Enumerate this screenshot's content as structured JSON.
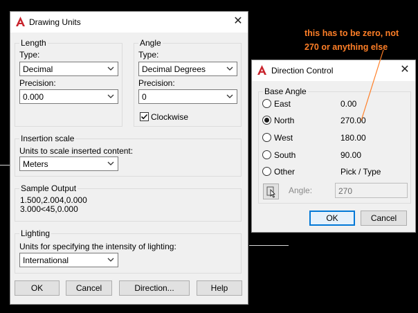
{
  "drawing_units": {
    "title": "Drawing Units",
    "length": {
      "group_title": "Length",
      "type_label": "Type:",
      "type_value": "Decimal",
      "precision_label": "Precision:",
      "precision_value": "0.000"
    },
    "angle": {
      "group_title": "Angle",
      "type_label": "Type:",
      "type_value": "Decimal Degrees",
      "precision_label": "Precision:",
      "precision_value": "0",
      "clockwise_label": "Clockwise",
      "clockwise_checked": true
    },
    "insertion": {
      "group_title": "Insertion scale",
      "label": "Units to scale inserted content:",
      "value": "Meters"
    },
    "sample": {
      "group_title": "Sample Output",
      "line1": "1.500,2.004,0.000",
      "line2": "3.000<45,0.000"
    },
    "lighting": {
      "group_title": "Lighting",
      "label": "Units for specifying the intensity of lighting:",
      "value": "International"
    },
    "buttons": {
      "ok": "OK",
      "cancel": "Cancel",
      "direction": "Direction...",
      "help": "Help"
    }
  },
  "direction_control": {
    "title": "Direction Control",
    "group_title": "Base Angle",
    "options": [
      {
        "label": "East",
        "value": "0.00",
        "selected": false
      },
      {
        "label": "North",
        "value": "270.00",
        "selected": true
      },
      {
        "label": "West",
        "value": "180.00",
        "selected": false
      },
      {
        "label": "South",
        "value": "90.00",
        "selected": false
      },
      {
        "label": "Other",
        "value": "Pick / Type",
        "selected": false
      }
    ],
    "angle_label": "Angle:",
    "angle_value": "270",
    "buttons": {
      "ok": "OK",
      "cancel": "Cancel"
    }
  },
  "annotation": {
    "line1": "this has to be zero, not",
    "line2": "270 or anything else",
    "color": "#ff7f27"
  },
  "colors": {
    "accent": "#0078d7",
    "logo_red": "#c8232c"
  }
}
